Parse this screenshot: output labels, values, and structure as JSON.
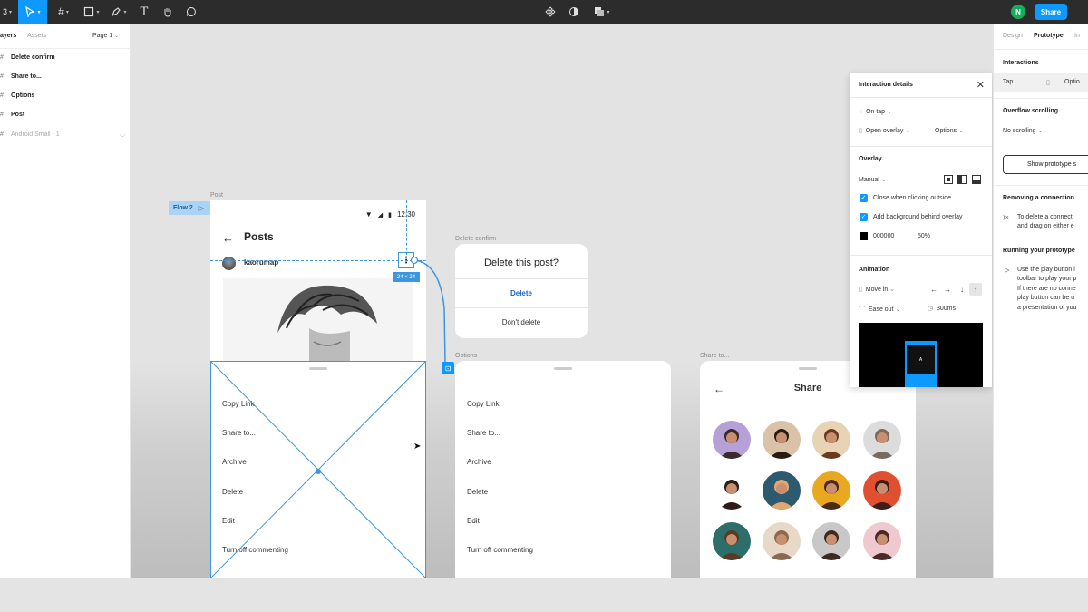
{
  "toolbar": {
    "left_tools": [
      "figma-menu",
      "move-tool",
      "frame-tool",
      "shape-tool",
      "pen-tool",
      "text-tool",
      "hand-tool",
      "comment-tool"
    ],
    "center_tools": [
      "component-icon",
      "mask-icon",
      "boolean-icon"
    ],
    "user_initial": "N",
    "share_label": "Share"
  },
  "left_panel": {
    "tabs": [
      "ayers",
      "Assets"
    ],
    "page_selector": "Page 1",
    "layers": [
      {
        "name": "Delete confirm",
        "dim": false
      },
      {
        "name": "Share to...",
        "dim": false
      },
      {
        "name": "Options",
        "dim": false
      },
      {
        "name": "Post",
        "dim": false
      },
      {
        "name": "Android Small - 1",
        "dim": true
      }
    ]
  },
  "canvas": {
    "flow_tag": "Flow 2",
    "frame_labels": {
      "post": "Post",
      "delete_confirm": "Delete confirm",
      "options": "Options",
      "share_to": "Share to..."
    },
    "post": {
      "time": "12:30",
      "title": "Posts",
      "username": "kaorumap"
    },
    "size_badge": "24 × 24",
    "sheet_items": [
      "Copy Link",
      "Share to...",
      "Archive",
      "Delete",
      "Edit",
      "Turn off commenting"
    ],
    "delete_dialog": {
      "title": "Delete this post?",
      "primary": "Delete",
      "secondary": "Don't delete"
    },
    "share": {
      "title": "Share"
    }
  },
  "interaction_details": {
    "title": "Interaction details",
    "trigger": "On tap",
    "action": "Open overlay",
    "options_label": "Options",
    "overlay_heading": "Overlay",
    "position": "Manual",
    "close_outside": "Close when clicking outside",
    "add_background": "Add background behind overlay",
    "bg_color": "000000",
    "bg_opacity": "50%",
    "animation_heading": "Animation",
    "animation_type": "Move in",
    "easing": "Ease out",
    "duration": "300ms",
    "preview_label": "A"
  },
  "right_panel": {
    "tabs": [
      "Design",
      "Prototype",
      "In"
    ],
    "interactions_heading": "Interactions",
    "interaction_trigger": "Tap",
    "interaction_options": "Optio",
    "overflow_heading": "Overflow scrolling",
    "overflow_value": "No scrolling",
    "show_button": "Show prototype s",
    "removing_heading": "Removing a connection",
    "removing_text": [
      "To delete a connecti",
      "and drag on either e"
    ],
    "running_heading": "Running your prototype",
    "running_text": [
      "Use the play button i",
      "toolbar to play your p",
      "If there are no conne",
      "play button can be u",
      "a presentation of you"
    ]
  }
}
